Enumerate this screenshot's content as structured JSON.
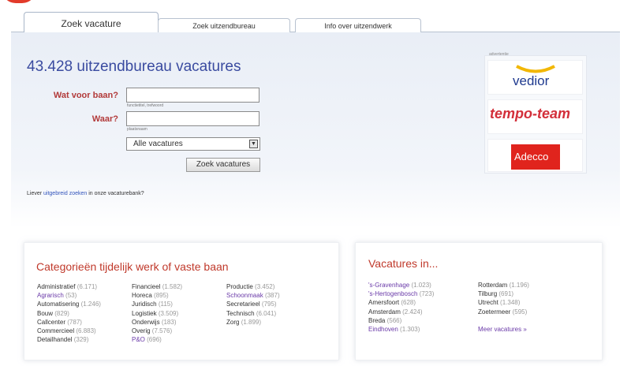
{
  "tabs": [
    "Zoek vacature",
    "Zoek uitzendbureau",
    "Info over uitzendwerk"
  ],
  "hero": {
    "title": "43.428 uitzendbureau vacatures",
    "what_label": "Wat voor baan?",
    "what_hint": "functietitel, trefwoord",
    "where_label": "Waar?",
    "where_hint": "plaatsnaam",
    "select_value": "Alle vacatures",
    "search_button": "Zoek vacatures",
    "adv_prefix": "Liever ",
    "adv_link": "uitgebreid zoeken",
    "adv_suffix": " in onze vacaturebank?"
  },
  "ads": {
    "label": "advertentie",
    "items": [
      "vedior",
      "tempo-team",
      "Adecco"
    ]
  },
  "categories": {
    "title": "Categorieën tijdelijk werk of vaste baan",
    "columns": [
      [
        {
          "name": "Administratief",
          "count": "(6.171)"
        },
        {
          "name": "Agrarisch",
          "count": "(53)"
        },
        {
          "name": "Automatisering",
          "count": "(1.246)"
        },
        {
          "name": "Bouw",
          "count": "(829)"
        },
        {
          "name": "Callcenter",
          "count": "(787)"
        },
        {
          "name": "Commercieel",
          "count": "(6.883)"
        },
        {
          "name": "Detailhandel",
          "count": "(329)"
        }
      ],
      [
        {
          "name": "Financieel",
          "count": "(1.582)"
        },
        {
          "name": "Horeca",
          "count": "(895)"
        },
        {
          "name": "Juridisch",
          "count": "(115)"
        },
        {
          "name": "Logistiek",
          "count": "(3.509)"
        },
        {
          "name": "Onderwijs",
          "count": "(183)"
        },
        {
          "name": "Overig",
          "count": "(7.576)"
        },
        {
          "name": "P&O",
          "count": "(696)"
        }
      ],
      [
        {
          "name": "Productie",
          "count": "(3.452)"
        },
        {
          "name": "Schoonmaak",
          "count": "(387)"
        },
        {
          "name": "Secretarieel",
          "count": "(795)"
        },
        {
          "name": "Technisch",
          "count": "(6.041)"
        },
        {
          "name": "Zorg",
          "count": "(1.899)"
        }
      ]
    ]
  },
  "cities": {
    "title": "Vacatures in...",
    "columns": [
      [
        {
          "name": "'s-Gravenhage",
          "count": "(1.023)"
        },
        {
          "name": "'s-Hertogenbosch",
          "count": "(723)"
        },
        {
          "name": "Amersfoort",
          "count": "(628)"
        },
        {
          "name": "Amsterdam",
          "count": "(2.424)"
        },
        {
          "name": "Breda",
          "count": "(566)"
        },
        {
          "name": "Eindhoven",
          "count": "(1.303)"
        }
      ],
      [
        {
          "name": "Rotterdam",
          "count": "(1.196)"
        },
        {
          "name": "Tilburg",
          "count": "(691)"
        },
        {
          "name": "Utrecht",
          "count": "(1.348)"
        },
        {
          "name": "Zoetermeer",
          "count": "(595)"
        }
      ]
    ],
    "more_link": "Meer vacatures »"
  },
  "colors": {
    "title": "#3a4ba0",
    "accent": "#c0392b",
    "link": "#6a3aa8"
  }
}
